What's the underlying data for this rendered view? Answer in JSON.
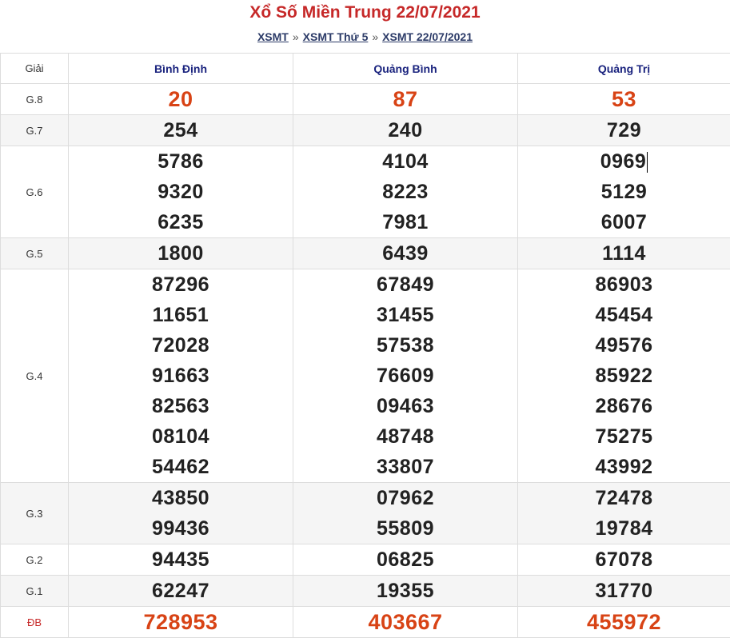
{
  "title": "Xổ Số Miền Trung 22/07/2021",
  "breadcrumb": {
    "items": [
      "XSMT",
      "XSMT Thứ 5",
      "XSMT 22/07/2021"
    ],
    "separator": "»"
  },
  "table": {
    "header": {
      "prize": "Giải",
      "provinces": [
        "Bình Định",
        "Quảng Bình",
        "Quảng Trị"
      ]
    },
    "rows": [
      {
        "label": "G.8",
        "values": [
          [
            "20"
          ],
          [
            "87"
          ],
          [
            "53"
          ]
        ]
      },
      {
        "label": "G.7",
        "values": [
          [
            "254"
          ],
          [
            "240"
          ],
          [
            "729"
          ]
        ]
      },
      {
        "label": "G.6",
        "values": [
          [
            "5786",
            "9320",
            "6235"
          ],
          [
            "4104",
            "8223",
            "7981"
          ],
          [
            "0969",
            "5129",
            "6007"
          ]
        ]
      },
      {
        "label": "G.5",
        "values": [
          [
            "1800"
          ],
          [
            "6439"
          ],
          [
            "1114"
          ]
        ]
      },
      {
        "label": "G.4",
        "values": [
          [
            "87296",
            "11651",
            "72028",
            "91663",
            "82563",
            "08104",
            "54462"
          ],
          [
            "67849",
            "31455",
            "57538",
            "76609",
            "09463",
            "48748",
            "33807"
          ],
          [
            "86903",
            "45454",
            "49576",
            "85922",
            "28676",
            "75275",
            "43992"
          ]
        ]
      },
      {
        "label": "G.3",
        "values": [
          [
            "43850",
            "99436"
          ],
          [
            "07962",
            "55809"
          ],
          [
            "72478",
            "19784"
          ]
        ]
      },
      {
        "label": "G.2",
        "values": [
          [
            "94435"
          ],
          [
            "06825"
          ],
          [
            "67078"
          ]
        ]
      },
      {
        "label": "G.1",
        "values": [
          [
            "62247"
          ],
          [
            "19355"
          ],
          [
            "31770"
          ]
        ]
      },
      {
        "label": "ĐB",
        "values": [
          [
            "728953"
          ],
          [
            "403667"
          ],
          [
            "455972"
          ]
        ]
      }
    ]
  },
  "colors": {
    "title": "#c62828",
    "special": "#d84315",
    "header": "#1a237e",
    "alt_row": "#f5f5f5"
  }
}
